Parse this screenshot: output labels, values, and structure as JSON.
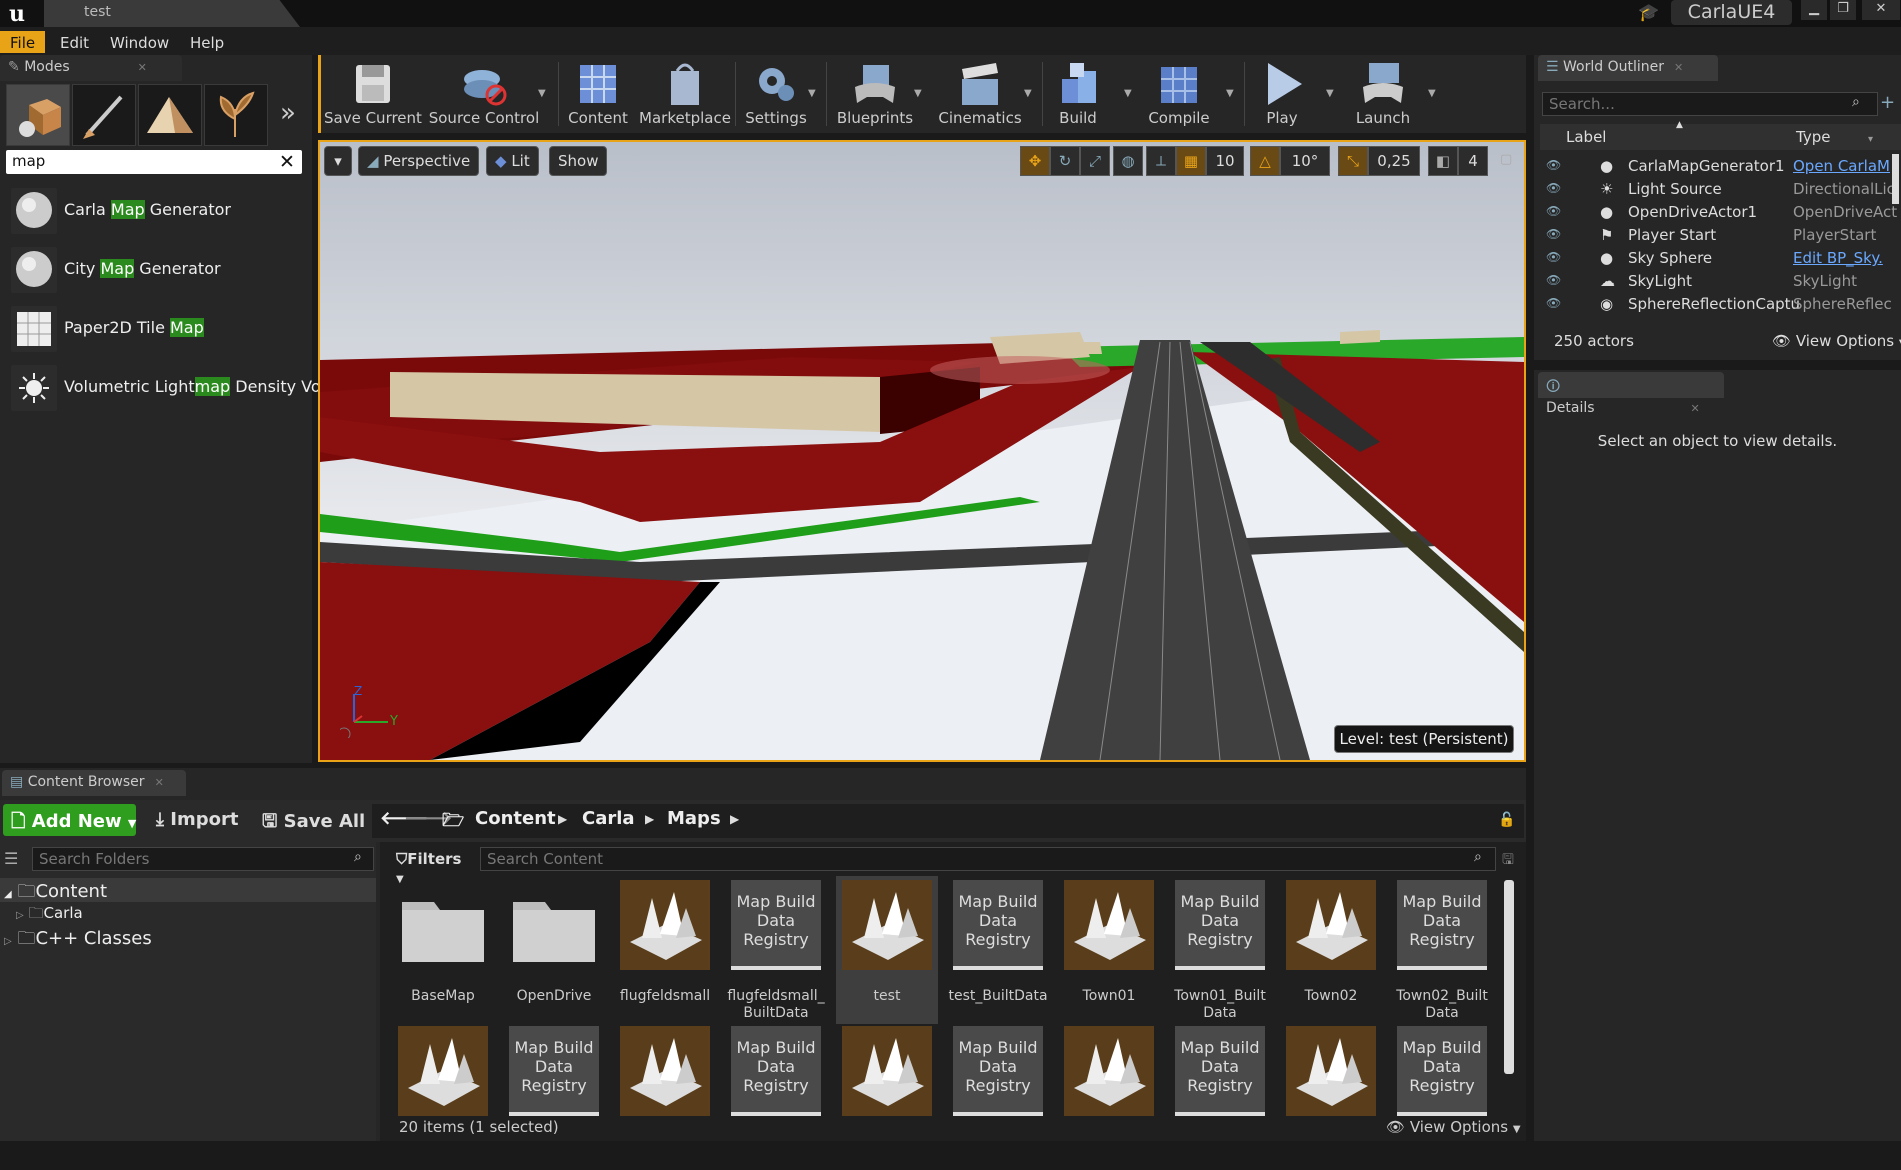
{
  "title_bar": {
    "doc_tab": "test",
    "project_badge": "CarlaUE4"
  },
  "menu": [
    "File",
    "Edit",
    "Window",
    "Help"
  ],
  "modes": {
    "tab_label": "Modes",
    "search_value": "map",
    "results": [
      {
        "pre": "Carla ",
        "hl": "Map",
        "post": " Generator"
      },
      {
        "pre": "City ",
        "hl": "Map",
        "post": " Generator"
      },
      {
        "pre": "Paper2D Tile ",
        "hl": "Map",
        "post": ""
      },
      {
        "pre": "Volumetric Light",
        "hl": "map",
        "post": " Density Vo"
      }
    ]
  },
  "toolbar": {
    "buttons": [
      "Save Current",
      "Source Control",
      "Content",
      "Marketplace",
      "Settings",
      "Blueprints",
      "Cinematics",
      "Build",
      "Compile",
      "Play",
      "Launch"
    ]
  },
  "viewport": {
    "perspective": "Perspective",
    "lit": "Lit",
    "show": "Show",
    "grid_snap": "10",
    "rot_snap": "10°",
    "scale_snap": "0,25",
    "cam_speed": "4",
    "level_label": "Level:  test (Persistent)",
    "axis_z": "Z",
    "axis_y": "Y"
  },
  "content_browser": {
    "tab_label": "Content Browser",
    "add_new": "Add New",
    "import": "Import",
    "save_all": "Save All",
    "breadcrumb": [
      "Content",
      "Carla",
      "Maps"
    ],
    "search_folders_placeholder": "Search Folders",
    "filters": "Filters",
    "search_content_placeholder": "Search Content",
    "tree": {
      "root": "Content",
      "child": "Carla",
      "cpp": "C++ Classes"
    },
    "mbdr_label": "Map Build Data Registry",
    "assets_row1": [
      {
        "name": "BaseMap",
        "kind": "folder"
      },
      {
        "name": "OpenDrive",
        "kind": "folder"
      },
      {
        "name": "flugfeldsmall",
        "kind": "level"
      },
      {
        "name": "flugfeldsmall_\nBuiltData",
        "kind": "mbdr"
      },
      {
        "name": "test",
        "kind": "level",
        "selected": true
      },
      {
        "name": "test_BuiltData",
        "kind": "mbdr"
      },
      {
        "name": "Town01",
        "kind": "level"
      },
      {
        "name": "Town01_Built\nData",
        "kind": "mbdr"
      },
      {
        "name": "Town02",
        "kind": "level"
      },
      {
        "name": "Town02_Built\nData",
        "kind": "mbdr"
      }
    ],
    "assets_row2": [
      "level",
      "mbdr",
      "level",
      "mbdr",
      "level",
      "mbdr",
      "level",
      "mbdr",
      "level",
      "mbdr"
    ],
    "status_left": "20 items (1 selected)",
    "view_options": "View Options"
  },
  "outliner": {
    "tab_label": "World Outliner",
    "search_placeholder": "Search...",
    "col_label": "Label",
    "col_type": "Type",
    "rows": [
      {
        "label": "CarlaMapGenerator1",
        "type": "Open CarlaM",
        "link": true
      },
      {
        "label": "Light Source",
        "type": "DirectionalLic",
        "link": false
      },
      {
        "label": "OpenDriveActor1",
        "type": "OpenDriveAct",
        "link": false
      },
      {
        "label": "Player Start",
        "type": "PlayerStart",
        "link": false
      },
      {
        "label": "Sky Sphere",
        "type": "Edit BP_Sky.",
        "link": true
      },
      {
        "label": "SkyLight",
        "type": "SkyLight",
        "link": false
      },
      {
        "label": "SphereReflectionCaptur",
        "type": "SphereReflec",
        "link": false
      }
    ],
    "actor_count": "250 actors",
    "view_options": "View Options"
  },
  "details": {
    "tab_label": "Details",
    "empty_text": "Select an object to view details."
  },
  "colors": {
    "accent": "#e8a317",
    "add_new": "#2f9e1e",
    "highlight": "#2b8a1e",
    "link": "#6aa8ff",
    "building": "#7a0a0a",
    "grass": "#1f9e1a"
  }
}
